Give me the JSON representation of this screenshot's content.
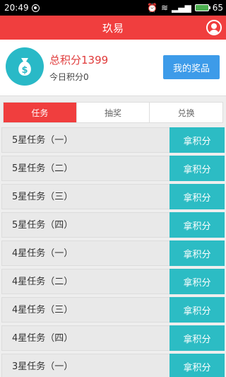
{
  "status_bar": {
    "time": "20:49",
    "battery": "65"
  },
  "app_bar": {
    "title": "玖易"
  },
  "header": {
    "total_points": "总积分1399",
    "today_points": "今日积分0",
    "my_prize_label": "我的奖品"
  },
  "tabs": [
    {
      "label": "任务",
      "active": true
    },
    {
      "label": "抽奖",
      "active": false
    },
    {
      "label": "兑换",
      "active": false
    }
  ],
  "tasks": [
    {
      "label": "5星任务（一）",
      "button": "拿积分"
    },
    {
      "label": "5星任务（二）",
      "button": "拿积分"
    },
    {
      "label": "5星任务（三）",
      "button": "拿积分"
    },
    {
      "label": "5星任务（四）",
      "button": "拿积分"
    },
    {
      "label": "4星任务（一）",
      "button": "拿积分"
    },
    {
      "label": "4星任务（二）",
      "button": "拿积分"
    },
    {
      "label": "4星任务（三）",
      "button": "拿积分"
    },
    {
      "label": "4星任务（四）",
      "button": "拿积分"
    },
    {
      "label": "3星任务（一）",
      "button": "拿积分"
    }
  ],
  "colors": {
    "accent": "#f03e3e",
    "teal": "#2cbcc4",
    "blue": "#3d9be9"
  }
}
